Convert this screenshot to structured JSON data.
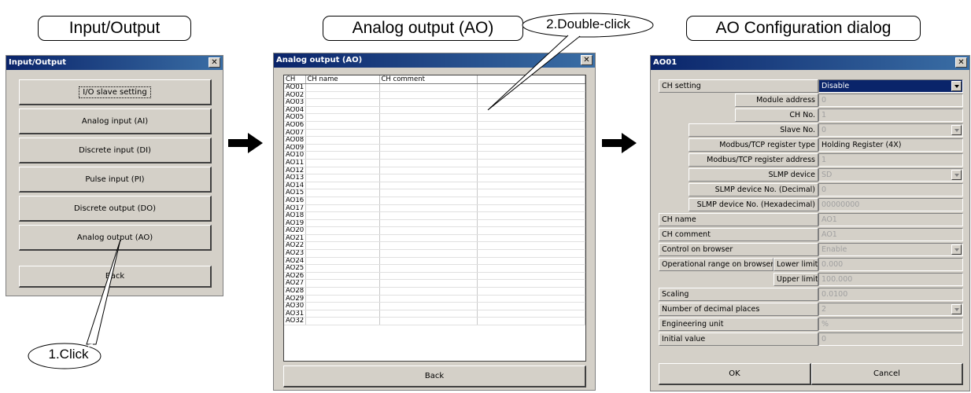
{
  "captions": {
    "input_output": "Input/Output",
    "analog_output": "Analog output (AO)",
    "ao_config": "AO Configuration dialog",
    "double_click": "2.Double-click",
    "click": "1.Click"
  },
  "io_window": {
    "title": "Input/Output",
    "buttons": [
      "I/O slave setting",
      "Analog input (AI)",
      "Discrete input (DI)",
      "Pulse input (PI)",
      "Discrete output (DO)",
      "Analog output (AO)"
    ],
    "back": "Back"
  },
  "ao_window": {
    "title": "Analog output (AO)",
    "columns": [
      "CH",
      "CH name",
      "CH comment",
      ""
    ],
    "rows": [
      "AO01",
      "AO02",
      "AO03",
      "AO04",
      "AO05",
      "AO06",
      "AO07",
      "AO08",
      "AO09",
      "AO10",
      "AO11",
      "AO12",
      "AO13",
      "AO14",
      "AO15",
      "AO16",
      "AO17",
      "AO18",
      "AO19",
      "AO20",
      "AO21",
      "AO22",
      "AO23",
      "AO24",
      "AO25",
      "AO26",
      "AO27",
      "AO28",
      "AO29",
      "AO30",
      "AO31",
      "AO32"
    ],
    "back": "Back"
  },
  "config_window": {
    "title": "AO01",
    "ch_setting": {
      "label": "CH setting",
      "value": "Disable"
    },
    "module_address": {
      "label": "Module address",
      "value": "0"
    },
    "ch_no": {
      "label": "CH No.",
      "value": "1"
    },
    "slave_no": {
      "label": "Slave No.",
      "value": "0"
    },
    "modbus_reg_type": {
      "label": "Modbus/TCP register type",
      "value": "Holding Register (4X)"
    },
    "modbus_reg_addr": {
      "label": "Modbus/TCP register address",
      "value": "1"
    },
    "slmp_device": {
      "label": "SLMP device",
      "value": "SD"
    },
    "slmp_dec": {
      "label": "SLMP device No. (Decimal)",
      "value": "0"
    },
    "slmp_hex": {
      "label": "SLMP device No. (Hexadecimal)",
      "value": "00000000"
    },
    "ch_name": {
      "label": "CH name",
      "value": "AO1"
    },
    "ch_comment": {
      "label": "CH comment",
      "value": "AO1"
    },
    "control_browser": {
      "label": "Control on browser",
      "value": "Enable"
    },
    "op_range": {
      "label": "Operational range on browser",
      "lower_label": "Lower limit",
      "lower_value": "0.000",
      "upper_label": "Upper limit",
      "upper_value": "100.000"
    },
    "scaling": {
      "label": "Scaling",
      "value": "0.0100"
    },
    "decimals": {
      "label": "Number of decimal places",
      "value": "2"
    },
    "eng_unit": {
      "label": "Engineering unit",
      "value": "%"
    },
    "initial": {
      "label": "Initial value",
      "value": "0"
    },
    "ok": "OK",
    "cancel": "Cancel"
  }
}
